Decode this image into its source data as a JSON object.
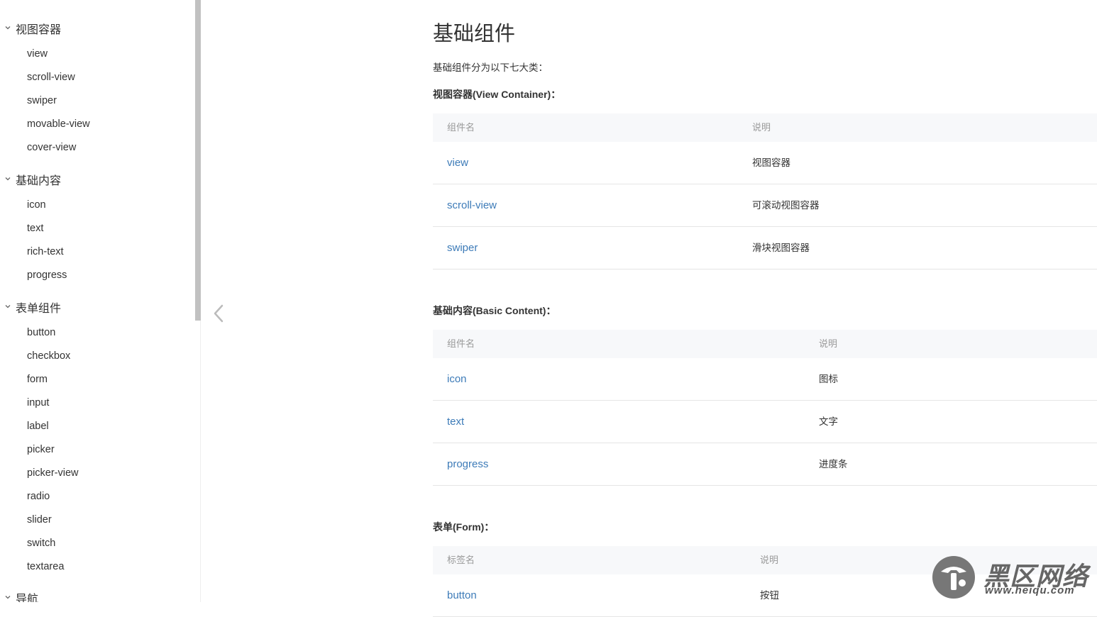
{
  "sidebar": {
    "groups": [
      {
        "title": "视图容器",
        "items": [
          "view",
          "scroll-view",
          "swiper",
          "movable-view",
          "cover-view"
        ]
      },
      {
        "title": "基础内容",
        "items": [
          "icon",
          "text",
          "rich-text",
          "progress"
        ]
      },
      {
        "title": "表单组件",
        "items": [
          "button",
          "checkbox",
          "form",
          "input",
          "label",
          "picker",
          "picker-view",
          "radio",
          "slider",
          "switch",
          "textarea"
        ]
      },
      {
        "title": "导航",
        "items": []
      }
    ]
  },
  "main": {
    "title": "基础组件",
    "intro": "基础组件分为以下七大类：",
    "sections": [
      {
        "title": "视图容器(View Container)：",
        "col1": "组件名",
        "col2": "说明",
        "rows": [
          {
            "name": "view",
            "desc": "视图容器"
          },
          {
            "name": "scroll-view",
            "desc": "可滚动视图容器"
          },
          {
            "name": "swiper",
            "desc": "滑块视图容器"
          }
        ]
      },
      {
        "title": "基础内容(Basic Content)：",
        "col1": "组件名",
        "col2": "说明",
        "rows": [
          {
            "name": "icon",
            "desc": "图标"
          },
          {
            "name": "text",
            "desc": "文字"
          },
          {
            "name": "progress",
            "desc": "进度条"
          }
        ]
      },
      {
        "title": "表单(Form)：",
        "col1": "标签名",
        "col2": "说明",
        "rows": [
          {
            "name": "button",
            "desc": "按钮"
          }
        ]
      }
    ]
  },
  "watermark": {
    "text": "黑区网络",
    "url": "www.heiqu.com"
  },
  "colors": {
    "link": "#3d7bb8",
    "header_bg": "#f7f8fa",
    "scroll_thumb": "#c1c1c1"
  }
}
